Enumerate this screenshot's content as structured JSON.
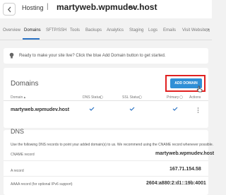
{
  "header": {
    "breadcrumb_parent": "Hosting",
    "separator": "|",
    "site_name": "martyweb.wpmudev.host"
  },
  "tabs": [
    {
      "label": "Overview",
      "active": false
    },
    {
      "label": "Domains",
      "active": true
    },
    {
      "label": "SFTP/SSH",
      "active": false
    },
    {
      "label": "Tools",
      "active": false
    },
    {
      "label": "Backups",
      "active": false
    },
    {
      "label": "Analytics",
      "active": false
    },
    {
      "label": "Staging",
      "active": false
    },
    {
      "label": "Logs",
      "active": false
    },
    {
      "label": "Emails",
      "active": false
    },
    {
      "label": "Visit Website",
      "active": false
    }
  ],
  "notice": {
    "icon": "lightbulb-icon",
    "text": "Ready to make your site live? Click the blue Add Domain button to get started."
  },
  "domains": {
    "title": "Domains",
    "add_button": "ADD DOMAIN",
    "columns": {
      "domain": "Domain",
      "dns_status": "DNS Status",
      "ssl_status": "SSL Status",
      "primary": "Primary",
      "actions": "Actions"
    },
    "rows": [
      {
        "domain": "martyweb.wpmudev.host",
        "dns_ok": true,
        "ssl_ok": true,
        "primary": true
      }
    ]
  },
  "dns": {
    "title": "DNS",
    "description": "Use the following DNS records to point your added domain(s) to us. We recommend using the CNAME record whenever possible.",
    "records": [
      {
        "label": "CNAME record",
        "value": "martyweb.wpmudev.host"
      },
      {
        "label": "A record",
        "value": "167.71.154.58"
      },
      {
        "label": "AAAA record (for optional IPv6 support)",
        "value": "2604:a880:2:d1::19b:4001"
      }
    ]
  },
  "colors": {
    "accent": "#2f8fd6",
    "highlight": "#e02020",
    "check": "#2a72c4"
  }
}
